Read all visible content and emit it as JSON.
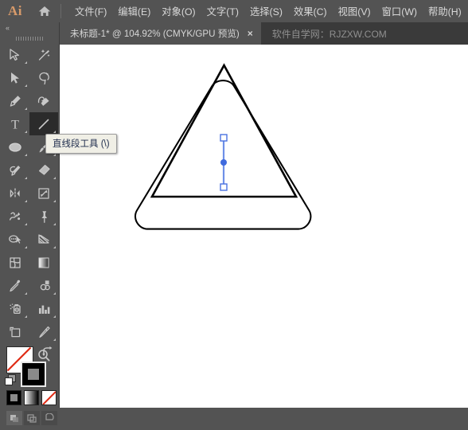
{
  "app": {
    "logo_text": "Ai",
    "home_icon": "home-icon"
  },
  "menubar": {
    "items": [
      {
        "label": "文件(F)",
        "name": "menu-file"
      },
      {
        "label": "编辑(E)",
        "name": "menu-edit"
      },
      {
        "label": "对象(O)",
        "name": "menu-object"
      },
      {
        "label": "文字(T)",
        "name": "menu-type"
      },
      {
        "label": "选择(S)",
        "name": "menu-select"
      },
      {
        "label": "效果(C)",
        "name": "menu-effect"
      },
      {
        "label": "视图(V)",
        "name": "menu-view"
      },
      {
        "label": "窗口(W)",
        "name": "menu-window"
      },
      {
        "label": "帮助(H)",
        "name": "menu-help"
      }
    ]
  },
  "tabbar": {
    "document_title": "未标题-1* @ 104.92% (CMYK/GPU 预览)",
    "close_label": "×",
    "watermark": "软件自学网：RJZXW.COM"
  },
  "toolpanel": {
    "collapse_label": "«",
    "tools": [
      {
        "label": "选择工具",
        "icon": "selection-arrow-icon",
        "selected": false
      },
      {
        "label": "魔棒工具",
        "icon": "magic-wand-icon",
        "selected": false
      },
      {
        "label": "直接选择工具",
        "icon": "direct-selection-arrow-icon",
        "selected": false
      },
      {
        "label": "套索工具",
        "icon": "lasso-icon",
        "selected": false
      },
      {
        "label": "钢笔工具",
        "icon": "pen-icon",
        "selected": false
      },
      {
        "label": "曲率工具",
        "icon": "curvature-icon",
        "selected": false
      },
      {
        "label": "文字工具",
        "icon": "type-t-icon",
        "selected": false
      },
      {
        "label": "直线段工具",
        "icon": "line-segment-icon",
        "selected": true
      },
      {
        "label": "椭圆工具",
        "icon": "ellipse-icon",
        "selected": false
      },
      {
        "label": "画笔工具",
        "icon": "paintbrush-icon",
        "selected": false
      },
      {
        "label": "Shaper 工具",
        "icon": "shaper-icon",
        "selected": false
      },
      {
        "label": "橡皮擦工具",
        "icon": "eraser-icon",
        "selected": false
      },
      {
        "label": "旋转工具",
        "icon": "rotate-reflect-icon",
        "selected": false
      },
      {
        "label": "比例缩放工具",
        "icon": "scale-icon",
        "selected": false
      },
      {
        "label": "宽度工具",
        "icon": "width-warp-icon",
        "selected": false
      },
      {
        "label": "自由变换工具",
        "icon": "free-transform-pin-icon",
        "selected": false
      },
      {
        "label": "形状生成器工具",
        "icon": "shape-builder-icon",
        "selected": false
      },
      {
        "label": "透视网格工具",
        "icon": "perspective-grid-icon",
        "selected": false
      },
      {
        "label": "网格工具",
        "icon": "mesh-icon",
        "selected": false
      },
      {
        "label": "渐变工具",
        "icon": "gradient-icon",
        "selected": false
      },
      {
        "label": "吸管工具",
        "icon": "eyedropper-icon",
        "selected": false
      },
      {
        "label": "混合工具",
        "icon": "blend-icon",
        "selected": false
      },
      {
        "label": "符号喷枪工具",
        "icon": "symbol-sprayer-icon",
        "selected": false
      },
      {
        "label": "柱形图工具",
        "icon": "column-graph-icon",
        "selected": false
      },
      {
        "label": "画板工具",
        "icon": "artboard-icon",
        "selected": false
      },
      {
        "label": "切片工具",
        "icon": "slice-knife-icon",
        "selected": false
      },
      {
        "label": "抓手工具",
        "icon": "hand-icon",
        "selected": false
      },
      {
        "label": "缩放工具",
        "icon": "zoom-magnifier-icon",
        "selected": false
      }
    ]
  },
  "tooltip": {
    "text": "直线段工具 (\\)"
  },
  "color_controls": {
    "fill": "none",
    "fill_color": "#ffffff",
    "stroke_color": "#000000",
    "swap_icon": "swap-fill-stroke-icon",
    "default_icon": "default-fill-stroke-icon",
    "modes": [
      {
        "label": "颜色",
        "icon": "color-swatch-icon",
        "active": true
      },
      {
        "label": "渐变",
        "icon": "gradient-swatch-icon",
        "active": false
      },
      {
        "label": "无",
        "icon": "none-swatch-icon",
        "active": false
      }
    ],
    "draw_modes": [
      {
        "label": "正常绘图",
        "icon": "draw-normal-icon",
        "active": true
      },
      {
        "label": "背面绘图",
        "icon": "draw-behind-icon",
        "active": false
      },
      {
        "label": "内部绘图",
        "icon": "draw-inside-icon",
        "active": false
      }
    ]
  },
  "canvas": {
    "background": "#ffffff",
    "selection_color": "#4a72e0",
    "shapes": [
      {
        "name": "outer-rounded-triangle",
        "type": "triangle-rounded",
        "stroke": "#000000"
      },
      {
        "name": "inner-triangle",
        "type": "triangle",
        "stroke": "#000000"
      },
      {
        "name": "selected-line-segment",
        "type": "line",
        "stroke": "#4a72e0"
      }
    ]
  }
}
